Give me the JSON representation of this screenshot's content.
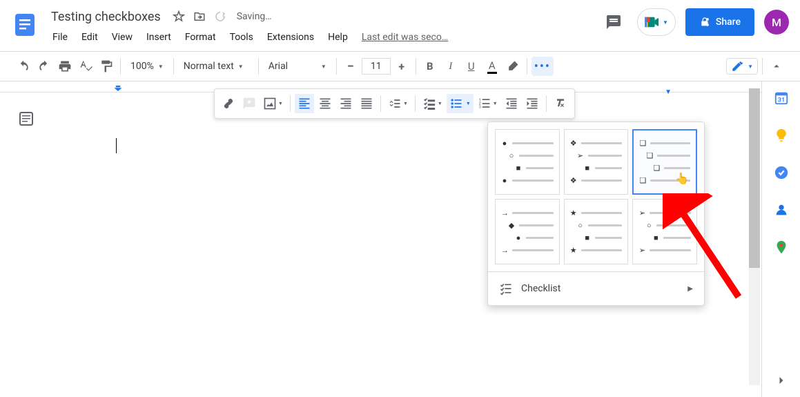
{
  "doc": {
    "title": "Testing checkboxes",
    "saving_status": "Saving…",
    "last_edit": "Last edit was seco…"
  },
  "menubar": {
    "items": [
      "File",
      "Edit",
      "View",
      "Insert",
      "Format",
      "Tools",
      "Extensions",
      "Help"
    ]
  },
  "header": {
    "share_label": "Share",
    "avatar_initial": "M"
  },
  "toolbar": {
    "zoom": "100%",
    "style": "Normal text",
    "font": "Arial",
    "font_size": "11"
  },
  "bullet_popup": {
    "checklist_label": "Checklist"
  },
  "bullet_styles": [
    {
      "glyphs": [
        "●",
        "○",
        "■"
      ],
      "indents": [
        0,
        1,
        2,
        0
      ]
    },
    {
      "glyphs": [
        "❖",
        "➢",
        "■"
      ],
      "indents": [
        0,
        1,
        2,
        0
      ]
    },
    {
      "glyphs": [
        "❏",
        "❏",
        "❏"
      ],
      "indents": [
        0,
        1,
        2,
        0
      ],
      "selected": true
    },
    {
      "glyphs": [
        "→",
        "◆",
        "●"
      ],
      "indents": [
        0,
        1,
        2,
        0
      ]
    },
    {
      "glyphs": [
        "★",
        "○",
        "■"
      ],
      "indents": [
        0,
        1,
        2,
        0
      ]
    },
    {
      "glyphs": [
        "➢",
        "○",
        "■"
      ],
      "indents": [
        0,
        1,
        2,
        0
      ]
    }
  ],
  "side_panel": {
    "icons": [
      "calendar",
      "keep",
      "tasks",
      "contacts",
      "maps"
    ]
  }
}
